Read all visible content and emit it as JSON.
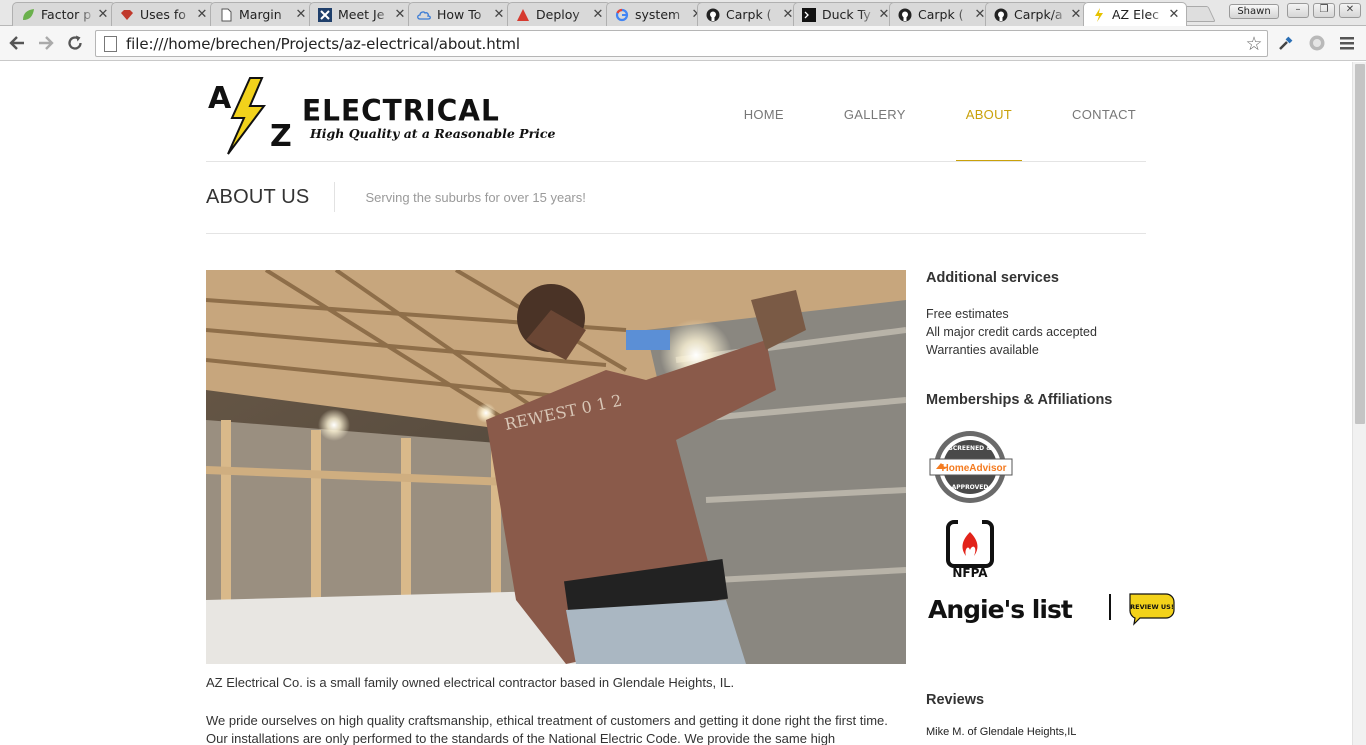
{
  "browser": {
    "tabs": [
      {
        "title": "Factor p",
        "icon": "leaf-icon"
      },
      {
        "title": "Uses fo",
        "icon": "gem-icon"
      },
      {
        "title": "Margin",
        "icon": "document-icon"
      },
      {
        "title": "Meet Je",
        "icon": "confluence-icon"
      },
      {
        "title": "How To",
        "icon": "cloud-icon"
      },
      {
        "title": "Deploy",
        "icon": "triangle-icon"
      },
      {
        "title": "system",
        "icon": "google-icon"
      },
      {
        "title": "Carpk (",
        "icon": "github-icon"
      },
      {
        "title": "Duck Ty",
        "icon": "terminal-icon"
      },
      {
        "title": "Carpk (",
        "icon": "github-icon"
      },
      {
        "title": "Carpk/a",
        "icon": "github-icon"
      },
      {
        "title": "AZ Elec",
        "icon": "lightning-icon",
        "active": true
      }
    ],
    "profile_name": "Shawn",
    "url": "file:///home/brechen/Projects/az-electrical/about.html"
  },
  "site": {
    "logo": {
      "letters": "A Z",
      "brand": "ELECTRICAL",
      "tagline": "High Quality at a Reasonable Price"
    },
    "nav": [
      {
        "label": "HOME",
        "active": false
      },
      {
        "label": "GALLERY",
        "active": false
      },
      {
        "label": "ABOUT",
        "active": true
      },
      {
        "label": "CONTACT",
        "active": false
      }
    ],
    "accent_color": "#c9a10a",
    "page_title": "ABOUT US",
    "page_subtitle": "Serving the suburbs for over 15 years!",
    "body": {
      "p1": "AZ Electrical Co. is a small family owned electrical contractor based in Glendale Heights, IL.",
      "p2": "We pride ourselves on high quality craftsmanship, ethical treatment of customers and getting it done right the first time. Our installations are only performed to the standards of the National Electric Code. We provide the same high"
    },
    "photo_shirt_text": "REWEST 0 1 2",
    "sidebar": {
      "services_title": "Additional services",
      "services": [
        "Free estimates",
        "All major credit cards accepted",
        "Warranties available"
      ],
      "memberships_title": "Memberships & Affiliations",
      "homeadvisor": {
        "top": "SCREENED &",
        "name": "HomeAdvisor",
        "bottom": "APPROVED"
      },
      "nfpa": "NFPA",
      "angies": {
        "name": "Angie's list",
        "badge": "REVIEW US!"
      },
      "reviews_title": "Reviews",
      "review_author": "Mike M. of Glendale Heights,IL"
    }
  }
}
